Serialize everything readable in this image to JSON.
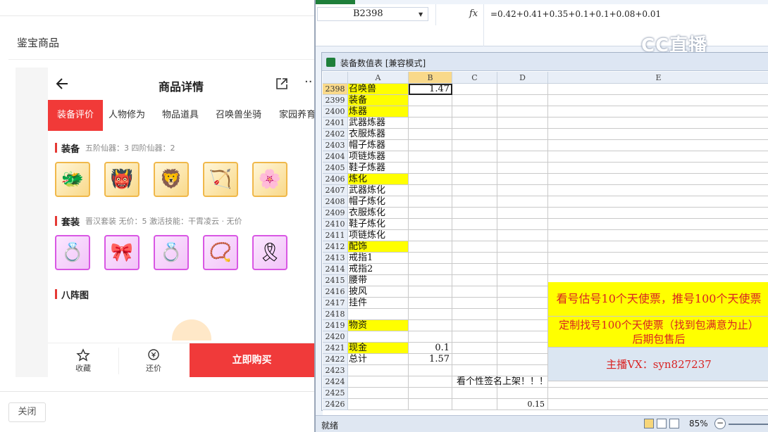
{
  "left": {
    "page_title": "鉴宝商品",
    "close_label": "关闭",
    "detail": {
      "title": "商品详情",
      "tabs": [
        "装备评价",
        "人物修为",
        "物品道具",
        "召唤兽坐骑",
        "家园养育"
      ],
      "sections": [
        {
          "title": "装备",
          "info": "五阶仙器：3  四阶仙器：2",
          "items": [
            "🐲",
            "👹",
            "🦁",
            "🏹",
            "🌸"
          ],
          "frame": "gold"
        },
        {
          "title": "套装",
          "info": "晋汉套装  无价：5  激活技能：干霄凌云 · 无价",
          "items": [
            "💍",
            "🎀",
            "💍",
            "📿",
            "🎗"
          ],
          "frame": "purple"
        },
        {
          "title": "八阵图",
          "info": "",
          "items": [],
          "frame": "gold"
        }
      ],
      "footer": {
        "fav_label": "收藏",
        "bargain_label": "还价",
        "buy_label": "立即购买"
      }
    }
  },
  "excel": {
    "name_box": "B2398",
    "fx": "fx",
    "formula": "=0.42+0.41+0.35+0.1+0.1+0.08+0.01",
    "watermark": "CC直播",
    "workbook_title": "装备数值表  [兼容模式]",
    "columns": [
      "A",
      "B",
      "C",
      "D",
      "E"
    ],
    "rows": [
      {
        "n": "2398",
        "a": "召唤兽",
        "b": "1.47",
        "ya": true
      },
      {
        "n": "2399",
        "a": "装备",
        "b": "",
        "ya": true
      },
      {
        "n": "2400",
        "a": "炼器",
        "b": "",
        "ya": true
      },
      {
        "n": "2401",
        "a": "武器炼器",
        "b": ""
      },
      {
        "n": "2402",
        "a": "衣服炼器",
        "b": ""
      },
      {
        "n": "2403",
        "a": "帽子炼器",
        "b": ""
      },
      {
        "n": "2404",
        "a": "项链炼器",
        "b": ""
      },
      {
        "n": "2405",
        "a": "鞋子炼器",
        "b": ""
      },
      {
        "n": "2406",
        "a": "炼化",
        "b": "",
        "ya": true
      },
      {
        "n": "2407",
        "a": "武器炼化",
        "b": ""
      },
      {
        "n": "2408",
        "a": "帽子炼化",
        "b": ""
      },
      {
        "n": "2409",
        "a": "衣服炼化",
        "b": ""
      },
      {
        "n": "2410",
        "a": "鞋子炼化",
        "b": ""
      },
      {
        "n": "2411",
        "a": "项链炼化",
        "b": ""
      },
      {
        "n": "2412",
        "a": "配饰",
        "b": "",
        "ya": true
      },
      {
        "n": "2413",
        "a": "戒指1",
        "b": ""
      },
      {
        "n": "2414",
        "a": "戒指2",
        "b": ""
      },
      {
        "n": "2415",
        "a": "腰带",
        "b": ""
      },
      {
        "n": "2416",
        "a": "披风",
        "b": ""
      },
      {
        "n": "2417",
        "a": "挂件",
        "b": ""
      },
      {
        "n": "2418",
        "a": "",
        "b": ""
      },
      {
        "n": "2419",
        "a": "物资",
        "b": "",
        "ya": true
      },
      {
        "n": "2420",
        "a": "",
        "b": ""
      },
      {
        "n": "2421",
        "a": "现金",
        "b": "0.1",
        "ya": true
      },
      {
        "n": "2422",
        "a": "总计",
        "b": "1.57"
      },
      {
        "n": "2423",
        "a": "",
        "b": ""
      },
      {
        "n": "2424",
        "a": "",
        "b": ""
      },
      {
        "n": "2425",
        "a": "",
        "b": ""
      },
      {
        "n": "2426",
        "a": "",
        "b": "",
        "d": "0.15"
      }
    ],
    "row_2424_overflow": "看个性签名上架！！！",
    "banner1": "看号估号10个天使票，推号100个天使票",
    "banner2_line1": "定制找号100个天使票（找到包满意为止）",
    "banner2_line2": "后期包售后",
    "banner3": "主播VX：syn827237",
    "status_ready": "就绪",
    "zoom": "85%",
    "colors": {
      "yellow": "#ffff00",
      "banner_bg": "#dbe6f2",
      "banner_text": "#d92222"
    }
  }
}
